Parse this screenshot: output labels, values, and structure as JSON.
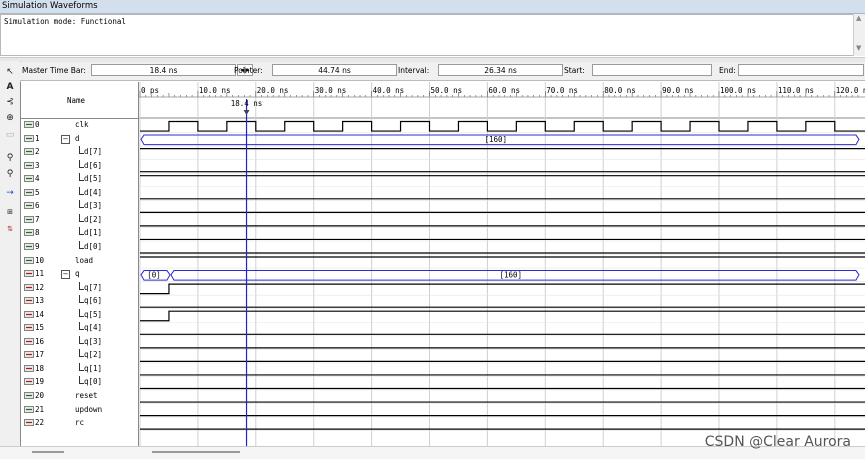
{
  "window": {
    "title": "Simulation Waveforms"
  },
  "messages": {
    "text": "Simulation mode: Functional"
  },
  "timebar": {
    "master_label": "Master Time Bar:",
    "master_value": "18.4 ns",
    "pointer_label": "Pointer:",
    "pointer_value": "44.74 ns",
    "interval_label": "Interval:",
    "interval_value": "26.34 ns",
    "start_label": "Start:",
    "start_value": "",
    "end_label": "End:",
    "end_value": ""
  },
  "name_header": "Name",
  "time_ticks": [
    "0 ps",
    "10.0 ns",
    "20.0 ns",
    "30.0 ns",
    "40.0 ns",
    "50.0 ns",
    "60.0 ns",
    "70.0 ns",
    "80.0 ns",
    "90.0 ns",
    "100.0 ns",
    "110.0 ns",
    "120.0 ns"
  ],
  "cursor_label": "18.4 ns",
  "cursor_time_ns": 18.4,
  "signals": [
    {
      "idx": "0",
      "name": "clk",
      "type": "in",
      "level": 0,
      "kind": "clock"
    },
    {
      "idx": "1",
      "name": "d",
      "type": "in",
      "level": 0,
      "kind": "bus",
      "group": true,
      "segments": [
        {
          "from": 0,
          "to": 124,
          "label": "[160]"
        }
      ]
    },
    {
      "idx": "2",
      "name": "d[7]",
      "type": "in",
      "level": 1,
      "kind": "const",
      "value": 1
    },
    {
      "idx": "3",
      "name": "d[6]",
      "type": "in",
      "level": 1,
      "kind": "const",
      "value": 0
    },
    {
      "idx": "4",
      "name": "d[5]",
      "type": "in",
      "level": 1,
      "kind": "const",
      "value": 1
    },
    {
      "idx": "5",
      "name": "d[4]",
      "type": "in",
      "level": 1,
      "kind": "const",
      "value": 0
    },
    {
      "idx": "6",
      "name": "d[3]",
      "type": "in",
      "level": 1,
      "kind": "const",
      "value": 0
    },
    {
      "idx": "7",
      "name": "d[2]",
      "type": "in",
      "level": 1,
      "kind": "const",
      "value": 0
    },
    {
      "idx": "8",
      "name": "d[1]",
      "type": "in",
      "level": 1,
      "kind": "const",
      "value": 0
    },
    {
      "idx": "9",
      "name": "d[0]",
      "type": "in",
      "level": 1,
      "kind": "const",
      "value": 0
    },
    {
      "idx": "10",
      "name": "load",
      "type": "in",
      "level": 0,
      "kind": "const",
      "value": 1
    },
    {
      "idx": "11",
      "name": "q",
      "type": "out",
      "level": 0,
      "kind": "bus",
      "group": true,
      "segments": [
        {
          "from": 0,
          "to": 5,
          "label": "[0]"
        },
        {
          "from": 5,
          "to": 124,
          "label": "[160]"
        }
      ]
    },
    {
      "idx": "12",
      "name": "q[7]",
      "type": "out",
      "level": 1,
      "kind": "step",
      "at": 5
    },
    {
      "idx": "13",
      "name": "q[6]",
      "type": "out",
      "level": 1,
      "kind": "const",
      "value": 0
    },
    {
      "idx": "14",
      "name": "q[5]",
      "type": "out",
      "level": 1,
      "kind": "step",
      "at": 5
    },
    {
      "idx": "15",
      "name": "q[4]",
      "type": "out",
      "level": 1,
      "kind": "const",
      "value": 0
    },
    {
      "idx": "16",
      "name": "q[3]",
      "type": "out",
      "level": 1,
      "kind": "const",
      "value": 0
    },
    {
      "idx": "17",
      "name": "q[2]",
      "type": "out",
      "level": 1,
      "kind": "const",
      "value": 0
    },
    {
      "idx": "18",
      "name": "q[1]",
      "type": "out",
      "level": 1,
      "kind": "const",
      "value": 0
    },
    {
      "idx": "19",
      "name": "q[0]",
      "type": "out",
      "level": 1,
      "kind": "const",
      "value": 0
    },
    {
      "idx": "20",
      "name": "reset",
      "type": "in",
      "level": 0,
      "kind": "const",
      "value": 0
    },
    {
      "idx": "21",
      "name": "updown",
      "type": "in",
      "level": 0,
      "kind": "const",
      "value": 0
    },
    {
      "idx": "22",
      "name": "rc",
      "type": "out",
      "level": 0,
      "kind": "const",
      "value": 0
    }
  ],
  "clock": {
    "period_ns": 10,
    "high_start_ns": 5
  },
  "colors": {
    "wave": "#000000",
    "bus": "#2a2ad0",
    "cursor": "#2222cc",
    "grid": "#d0d0d0"
  },
  "watermark": "CSDN @Clear Aurora"
}
